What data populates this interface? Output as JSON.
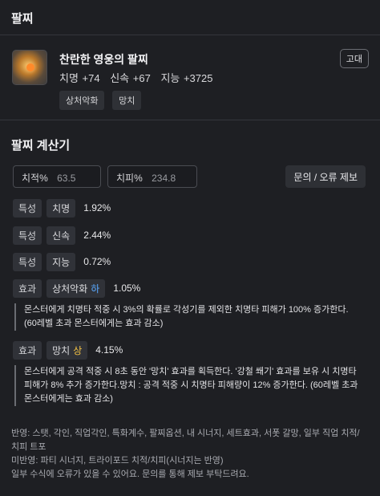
{
  "header": {
    "title": "팔찌"
  },
  "item": {
    "name": "찬란한 영웅의 팔찌",
    "grade": "고대",
    "stats": [
      "치명 +74",
      "신속 +67",
      "지능 +3725"
    ],
    "tags": [
      "상처악화",
      "망치"
    ],
    "icon": "bracelet-icon"
  },
  "calculator": {
    "title": "팔찌 계산기",
    "crit_rate": {
      "label": "치적%",
      "value": "63.5"
    },
    "crit_dmg": {
      "label": "치피%",
      "value": "234.8"
    },
    "report_button": "문의 / 오류 제보",
    "stat_rows": [
      {
        "type": "특성",
        "name": "치명",
        "value": "1.92%"
      },
      {
        "type": "특성",
        "name": "신속",
        "value": "2.44%"
      },
      {
        "type": "특성",
        "name": "지능",
        "value": "0.72%"
      }
    ],
    "effect_rows": [
      {
        "type": "효과",
        "name": "상처악화",
        "grade": "하",
        "value": "1.05%",
        "desc_lines": [
          "몬스터에게 치명타 적중 시 3%의 확률로 각성기를 제외한 치명타 피해가 100% 증가한다.",
          "(60레벨 초과 몬스터에게는 효과 감소)"
        ]
      },
      {
        "type": "효과",
        "name": "망치",
        "grade": "상",
        "value": "4.15%",
        "desc_lines": [
          "몬스터에게 공격 적중 시 8초 동안 '망치' 효과를 획득한다. '강철 쐐기' 효과를 보유 시 치명타",
          "피해가 8% 추가 증가한다.망치 : 공격 적중 시 치명타 피해량이 12% 증가한다. (60레벨 초과",
          "몬스터에게는 효과 감소)"
        ]
      }
    ],
    "notes": [
      "반영: 스탯, 각인, 직업각인, 특화계수, 팔찌옵션, 내 시너지, 세트효과, 서폿 갈망, 일부 직업 치적/",
      "치피 트포",
      "미반영: 파티 시너지, 트라이포드 치적/치피(시너지는 반영)",
      "일부 수식에 오류가 있을 수 있어요. 문의를 통해 제보 부탁드려요."
    ]
  },
  "colors": {
    "background": "#1e1f23",
    "grade_low": "#5aa9ff",
    "grade_high": "#f4c244"
  }
}
